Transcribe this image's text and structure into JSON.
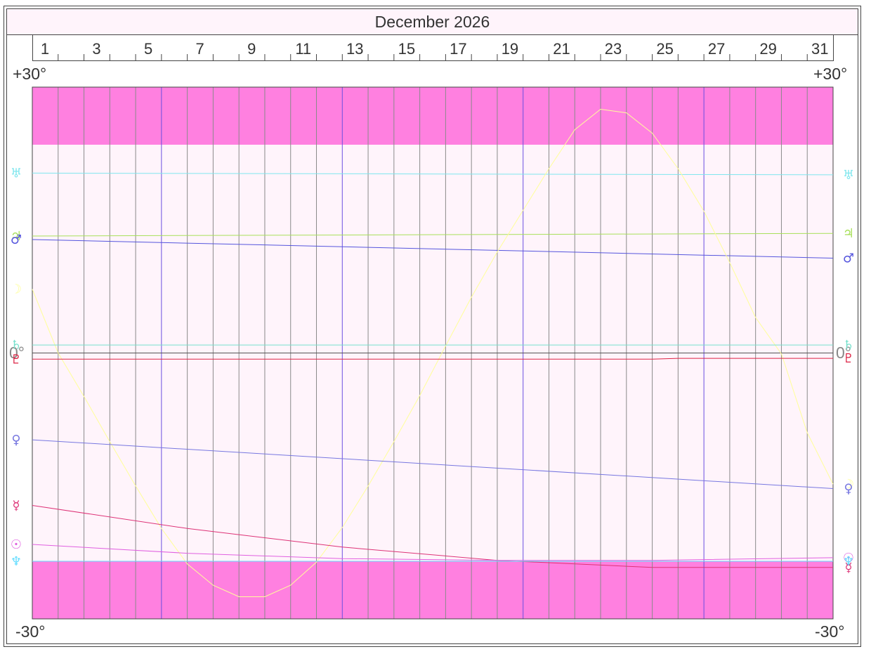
{
  "header": {
    "title": "December 2026"
  },
  "axis": {
    "top_left": "+30°",
    "top_right": "+30°",
    "bottom_left": "-30°",
    "bottom_right": "-30°",
    "zero_left": "0°",
    "zero_right": "0°"
  },
  "chart_data": {
    "type": "line",
    "title": "December 2026",
    "xlabel": "",
    "ylabel": "",
    "x_range": [
      1,
      32
    ],
    "ylim": [
      -30,
      30
    ],
    "x_tick_labels": [
      1,
      3,
      5,
      7,
      9,
      11,
      13,
      15,
      17,
      19,
      21,
      23,
      25,
      27,
      29,
      31
    ],
    "band": {
      "from": 23.5,
      "to": -23.5,
      "color": "#fff4fb"
    },
    "outer_fill_color": "#ff80e0",
    "grid": true,
    "series": [
      {
        "name": "♅",
        "color": "#7fe6ee",
        "x": [
          1,
          32
        ],
        "values": [
          20.3,
          20.1
        ]
      },
      {
        "name": "♃",
        "color": "#a8e05a",
        "x": [
          1,
          32
        ],
        "values": [
          13.2,
          13.5
        ]
      },
      {
        "name": "♂",
        "color": "#5555dd",
        "x": [
          1,
          32
        ],
        "values": [
          12.8,
          10.7
        ]
      },
      {
        "name": "☽",
        "color": "#ffff99",
        "x": [
          1,
          2,
          3,
          4,
          5,
          6,
          7,
          8,
          9,
          10,
          11,
          12,
          13,
          14,
          15,
          16,
          17,
          18,
          19,
          20,
          21,
          22,
          23,
          24,
          25,
          26,
          27,
          28,
          29,
          30,
          31,
          32
        ],
        "values": [
          7.2,
          0,
          -4.9,
          -10,
          -15,
          -19.8,
          -23.8,
          -26.2,
          -27.5,
          -27.5,
          -26.2,
          -23.6,
          -19.7,
          -15,
          -10,
          -4.8,
          0.8,
          6.3,
          11.4,
          16.1,
          20.8,
          25.2,
          27.5,
          27.1,
          24.8,
          20.8,
          16,
          10.2,
          4,
          -0.1,
          -9,
          -14.8
        ]
      },
      {
        "name": "♄",
        "color": "#77e0cc",
        "x": [
          1,
          32
        ],
        "values": [
          0.9,
          0.9
        ]
      },
      {
        "name": "♇",
        "color": "#dd2244",
        "x": [
          1,
          25,
          26,
          32
        ],
        "values": [
          -0.7,
          -0.7,
          -0.6,
          -0.6
        ]
      },
      {
        "name": "♀",
        "color": "#7777e0",
        "x": [
          1,
          32
        ],
        "values": [
          -9.8,
          -15.3
        ]
      },
      {
        "name": "☿",
        "color": "#dd3377",
        "x": [
          1,
          7,
          13,
          19,
          25,
          32
        ],
        "values": [
          -17.2,
          -19.8,
          -21.9,
          -23.4,
          -24.2,
          -24.2
        ]
      },
      {
        "name": "☉",
        "color": "#e060e0",
        "x": [
          1,
          7,
          13,
          19,
          25,
          32
        ],
        "values": [
          -21.6,
          -22.6,
          -23.2,
          -23.4,
          -23.4,
          -23.1
        ]
      },
      {
        "name": "♆",
        "color": "#66ddff",
        "x": [
          1,
          32
        ],
        "values": [
          -23.5,
          -23.5
        ]
      }
    ]
  }
}
